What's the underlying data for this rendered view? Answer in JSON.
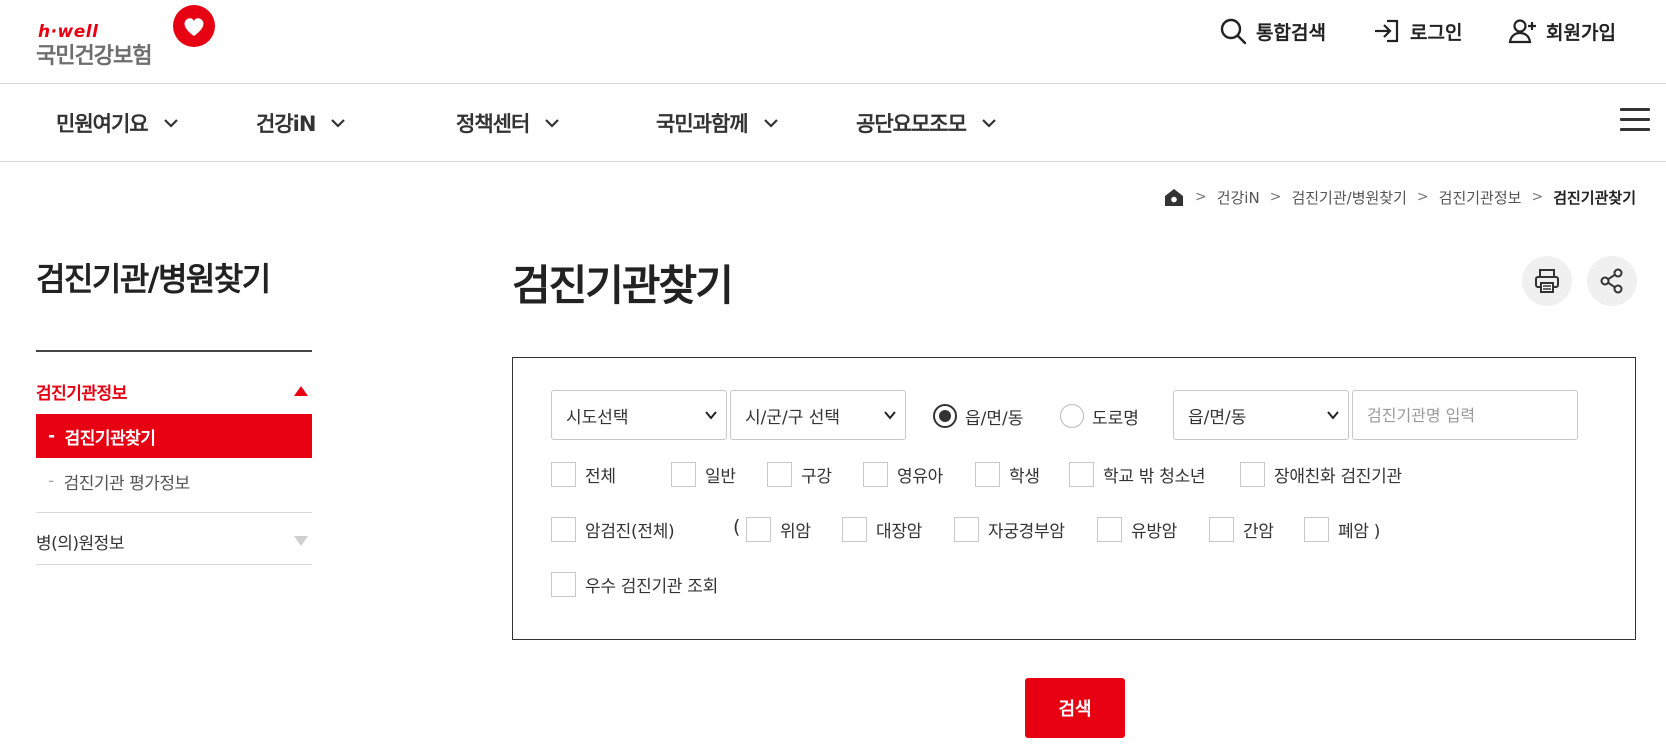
{
  "brand": {
    "tagline": "h·well",
    "name": "국민건강보험",
    "accent_color": "#e60012"
  },
  "util_menu": {
    "search_label": "통합검색",
    "login_label": "로그인",
    "join_label": "회원가입"
  },
  "gnb": {
    "items": [
      "민원여기요",
      "건강iN",
      "정책센터",
      "국민과함께",
      "공단요모조모"
    ]
  },
  "breadcrumb": {
    "items": [
      "건강iN",
      "검진기관/병원찾기",
      "검진기관정보"
    ],
    "current": "검진기관찾기"
  },
  "sidebar": {
    "title": "검진기관/병원찾기",
    "groups": [
      {
        "label": "검진기관정보",
        "expanded": true,
        "items": [
          {
            "label": "검진기관찾기",
            "active": true
          },
          {
            "label": "검진기관 평가정보",
            "active": false
          }
        ]
      },
      {
        "label": "병(의)원정보",
        "expanded": false
      }
    ]
  },
  "main": {
    "title": "검진기관찾기"
  },
  "search_form": {
    "sido_select": "시도선택",
    "sigungu_select": "시/군/구 선택",
    "address_type": {
      "options": [
        "읍/면/동",
        "도로명"
      ],
      "selected": "읍/면/동"
    },
    "emd_select": "읍/면/동",
    "name_placeholder": "검진기관명 입력",
    "types_row1": [
      "전체",
      "일반",
      "구강",
      "영유아",
      "학생",
      "학교 밖 청소년",
      "장애친화 검진기관"
    ],
    "cancer_all": "암검진(전체)",
    "open_paren": "(",
    "cancers": [
      "위암",
      "대장암",
      "자궁경부암",
      "유방암",
      "간암",
      "폐암 )"
    ],
    "excellent": "우수 검진기관 조회",
    "submit_label": "검색"
  }
}
